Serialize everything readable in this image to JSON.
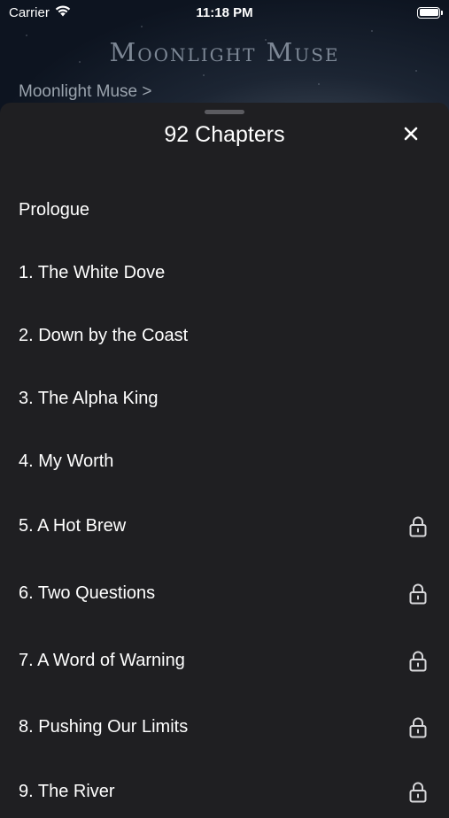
{
  "status_bar": {
    "carrier": "Carrier",
    "time": "11:18 PM"
  },
  "cover": {
    "title": "Moonlight Muse"
  },
  "breadcrumb": {
    "label": "Moonlight Muse >"
  },
  "sheet": {
    "title": "92 Chapters",
    "close_icon": "close-icon"
  },
  "chapters": [
    {
      "label": "Prologue",
      "locked": false
    },
    {
      "label": "1. The White Dove",
      "locked": false
    },
    {
      "label": "2. Down by the Coast",
      "locked": false
    },
    {
      "label": "3. The Alpha King",
      "locked": false
    },
    {
      "label": "4. My Worth",
      "locked": false
    },
    {
      "label": "5. A Hot Brew",
      "locked": true
    },
    {
      "label": "6. Two Questions",
      "locked": true
    },
    {
      "label": "7. A Word of Warning",
      "locked": true
    },
    {
      "label": "8. Pushing Our Limits",
      "locked": true
    },
    {
      "label": "9. The River",
      "locked": true
    }
  ]
}
